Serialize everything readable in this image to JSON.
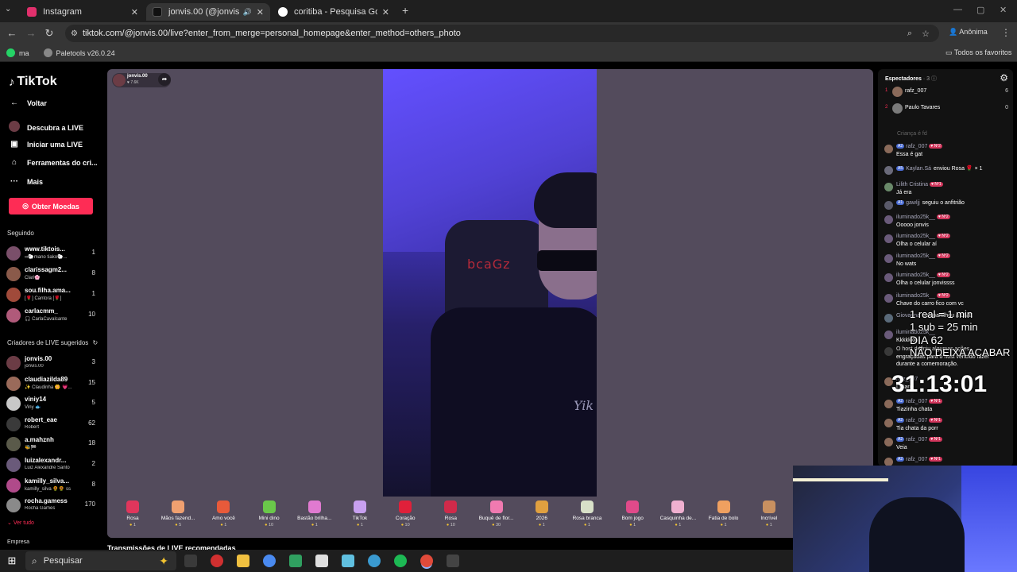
{
  "browser": {
    "tabs": [
      {
        "title": "Instagram",
        "color": "#e1306c",
        "active": false
      },
      {
        "title": "jonvis.00 (@jonvis.00) comente",
        "color": "#111111",
        "active": true
      },
      {
        "title": "coritiba - Pesquisa Google",
        "color": "#4285f4",
        "active": false
      }
    ],
    "new_tab": "+",
    "url": "tiktok.com/@jonvis.00/live?enter_from_merge=personal_homepage&enter_method=others_photo",
    "profile_label": "Anônima",
    "bookmarks": [
      {
        "label": "ma",
        "color": "#25d366"
      },
      {
        "label": "Paletools v26.0.24",
        "color": "#888888"
      }
    ],
    "all_bookmarks": "Todos os favoritos"
  },
  "sidebar": {
    "logo": "TikTok",
    "nav": [
      {
        "label": "Voltar",
        "icon": "arrow-left-icon"
      },
      {
        "label": "Descubra a LIVE",
        "icon": "live-avatar-icon"
      },
      {
        "label": "Iniciar uma LIVE",
        "icon": "camera-icon"
      },
      {
        "label": "Ferramentas do cri...",
        "icon": "home-icon"
      },
      {
        "label": "Mais",
        "icon": "more-icon"
      }
    ],
    "coins_button": "Obter Moedas",
    "following_header": "Seguindo",
    "following": [
      {
        "name": "www.tiktois...",
        "sub": "∞🐑mano tiako🐑...",
        "count": "1",
        "color": "#7a4f6a"
      },
      {
        "name": "clarissagm2...",
        "sub": "Clari🌸",
        "count": "8",
        "color": "#8a5a4a"
      },
      {
        "name": "sou.filha.ama...",
        "sub": "[🌹] Cantora [🌹]",
        "count": "1",
        "color": "#a04a3a"
      },
      {
        "name": "carlacmm_",
        "sub": "🎧 CarlaCavalcante",
        "count": "10",
        "color": "#b05a7a"
      }
    ],
    "suggested_header": "Criadores de LIVE sugeridos",
    "suggested": [
      {
        "name": "jonvis.00",
        "sub": "jonvis.00",
        "count": "3",
        "color": "#6b3c45"
      },
      {
        "name": "claudiazilda89",
        "sub": "✨ Claudinha 🌼 💗...",
        "count": "15",
        "color": "#9a6a5a"
      },
      {
        "name": "viniy14",
        "sub": "Viny 🐟",
        "count": "5",
        "color": "#c8c8c8"
      },
      {
        "name": "robert_eae",
        "sub": "Robert",
        "count": "62",
        "color": "#3a3a3a"
      },
      {
        "name": "a.mahznh",
        "sub": "🐝🏁",
        "count": "18",
        "color": "#5a5a4a"
      },
      {
        "name": "luizalexandr...",
        "sub": "Luiz Alexandre Santo",
        "count": "2",
        "color": "#6a5a7a"
      },
      {
        "name": "kamilly_silva...",
        "sub": "kamilly_silva 🌻🌻 ss",
        "count": "8",
        "color": "#b04a8a"
      },
      {
        "name": "rocha.gamess",
        "sub": "Rocha Games",
        "count": "170",
        "color": "#8a8a8a"
      }
    ],
    "see_all": "Ver tudo",
    "company": "Empresa"
  },
  "stream": {
    "host_name": "jonvis.00",
    "likes": "♥ 7.6K",
    "chair_text": "bcaGz",
    "shirt_text": "Yik",
    "recommended": "Transmissões de LIVE recomendadas",
    "gifts": [
      {
        "name": "Rosa",
        "price": "1",
        "color": "#e0365c"
      },
      {
        "name": "Mãos fazend...",
        "price": "5",
        "color": "#f0a070"
      },
      {
        "name": "Amo você",
        "price": "1",
        "color": "#e85a3a"
      },
      {
        "name": "Mini dino",
        "price": "10",
        "color": "#6ac84a"
      },
      {
        "name": "Bastão brilha...",
        "price": "1",
        "color": "#e07ad0"
      },
      {
        "name": "TikTok",
        "price": "1",
        "color": "#c8a0f0"
      },
      {
        "name": "Coração",
        "price": "10",
        "color": "#e0203a"
      },
      {
        "name": "Rosa",
        "price": "10",
        "color": "#d02a4a"
      },
      {
        "name": "Buquê de flor...",
        "price": "30",
        "color": "#f07ab0"
      },
      {
        "name": "2026",
        "price": "1",
        "color": "#e0a040"
      },
      {
        "name": "Rosa branca",
        "price": "1",
        "color": "#d8e0c8"
      },
      {
        "name": "Bom jogo",
        "price": "1",
        "color": "#e04a8a"
      },
      {
        "name": "Casquinha de...",
        "price": "1",
        "color": "#f0b0d0"
      },
      {
        "name": "Fatia de bolo",
        "price": "1",
        "color": "#f0a060"
      },
      {
        "name": "Incrível",
        "price": "1",
        "color": "#c89060"
      }
    ]
  },
  "chat": {
    "viewers_label": "Espectadores",
    "viewers_count": "· 3",
    "viewers": [
      {
        "rank": "1",
        "name": "rafz_007",
        "count": "6",
        "color": "#8a6a5a"
      },
      {
        "rank": "2",
        "name": "Paulo Tavares",
        "count": "0",
        "color": "#7a7a7a"
      }
    ],
    "faded_line": "Criança é fd",
    "messages": [
      {
        "level": "2",
        "user": "rafz_007",
        "fan": "2",
        "text": "Essa é gat",
        "color": "#8a6a5a"
      },
      {
        "level": "5",
        "user": "Kaylan.Sá",
        "fan": "",
        "text": "enviou Rosa 🌹 × 1",
        "inline": true,
        "color": "#6a6a7a"
      },
      {
        "level": "",
        "user": "Lilith Cristina",
        "fan": "1",
        "text": "Já era",
        "color": "#6a8a6a"
      },
      {
        "level": "1",
        "user": "gawljj",
        "fan": "",
        "text": "seguiu o anfitrião",
        "inline": true,
        "color": "#5a5a6a"
      },
      {
        "level": "",
        "user": "iluminado25k__",
        "fan": "2",
        "text": "Ooooo jonvis",
        "color": "#6a5a7a"
      },
      {
        "level": "",
        "user": "iluminado25k__",
        "fan": "2",
        "text": "Olha o celular aí",
        "color": "#6a5a7a"
      },
      {
        "level": "",
        "user": "iluminado25k__",
        "fan": "2",
        "text": "No wats",
        "color": "#6a5a7a"
      },
      {
        "level": "",
        "user": "iluminado25k__",
        "fan": "2",
        "text": "Olha o celular jonvissss",
        "color": "#6a5a7a"
      },
      {
        "level": "",
        "user": "iluminado25k__",
        "fan": "2",
        "text": "Chave do carro fico com vc",
        "color": "#6a5a7a"
      },
      {
        "level": "",
        "user": "Giovanna",
        "fan": "",
        "text": "compartilhou a LIVE",
        "inline": true,
        "color": "#5a6a7a"
      },
      {
        "level": "",
        "user": "iluminado25k__",
        "fan": "",
        "text": "Kkkkkkk",
        "color": "#6a5a7a"
      },
      {
        "level": "",
        "user": "",
        "fan": "",
        "text": "O host definiu algumas ações",
        "text2": "engraçadas para o host vencido fazer",
        "text3": "durante a comemoração.",
        "system": true,
        "color": "#3a3a3a"
      },
      {
        "level": "",
        "user": "rafz_007",
        "fan": "",
        "text": "Lisiane",
        "color": "#8a6a5a"
      },
      {
        "level": "2",
        "user": "rafz_007",
        "fan": "1",
        "text": "Tiazinha chata",
        "color": "#8a6a5a"
      },
      {
        "level": "2",
        "user": "rafz_007",
        "fan": "1",
        "text": "Tia chata da porr",
        "color": "#8a6a5a"
      },
      {
        "level": "2",
        "user": "rafz_007",
        "fan": "1",
        "text": "Veia",
        "color": "#8a6a5a"
      },
      {
        "level": "2",
        "user": "rafz_007",
        "fan": "1",
        "text": "",
        "color": "#8a6a5a"
      }
    ]
  },
  "overlay": {
    "line1": "1 real = 1 min",
    "line2": "1 sub = 25 min",
    "line3": "DIA 62",
    "line4": "NÃO DEIXA ACABAR",
    "timer": "31:13:01"
  },
  "taskbar": {
    "search_placeholder": "Pesquisar",
    "apps": [
      {
        "name": "task-view",
        "color": "#3a3a3a"
      },
      {
        "name": "app-red",
        "color": "#d03030"
      },
      {
        "name": "file-explorer",
        "color": "#f0c040"
      },
      {
        "name": "chrome",
        "color": "#4a8af0"
      },
      {
        "name": "app-green",
        "color": "#30a060"
      },
      {
        "name": "app-white",
        "color": "#e0e0e0"
      },
      {
        "name": "app-cyan",
        "color": "#60c0e0"
      },
      {
        "name": "edge",
        "color": "#3a9ad0"
      },
      {
        "name": "spotify",
        "color": "#1db954"
      },
      {
        "name": "chrome-active",
        "color": "#e04a3a"
      },
      {
        "name": "app-dark",
        "color": "#444444"
      }
    ]
  }
}
